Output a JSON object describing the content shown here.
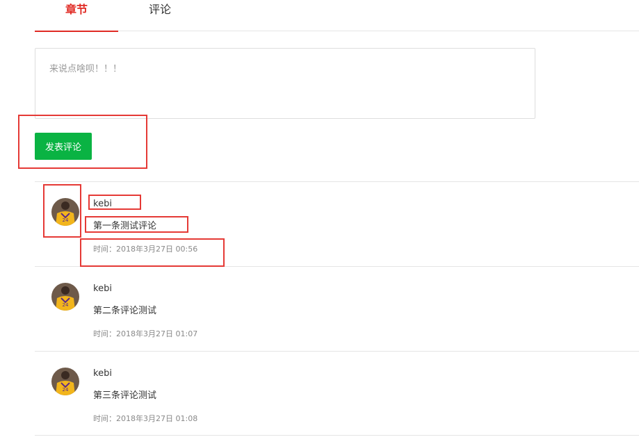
{
  "tabs": [
    {
      "label": "章节",
      "active": true
    },
    {
      "label": "评论",
      "active": false
    }
  ],
  "comment_form": {
    "placeholder": "来说点啥呗！！！",
    "value": "",
    "submit_label": "发表评论"
  },
  "comments": [
    {
      "user": "kebi",
      "text": "第一条测试评论",
      "time": "时间：2018年3月27日 00:56"
    },
    {
      "user": "kebi",
      "text": "第二条评论测试",
      "time": "时间：2018年3月27日 01:07"
    },
    {
      "user": "kebi",
      "text": "第三条评论测试",
      "time": "时间：2018年3月27日 01:08"
    }
  ],
  "colors": {
    "accent": "#e02a24",
    "button": "#0ab343",
    "annotation": "#e53935"
  }
}
